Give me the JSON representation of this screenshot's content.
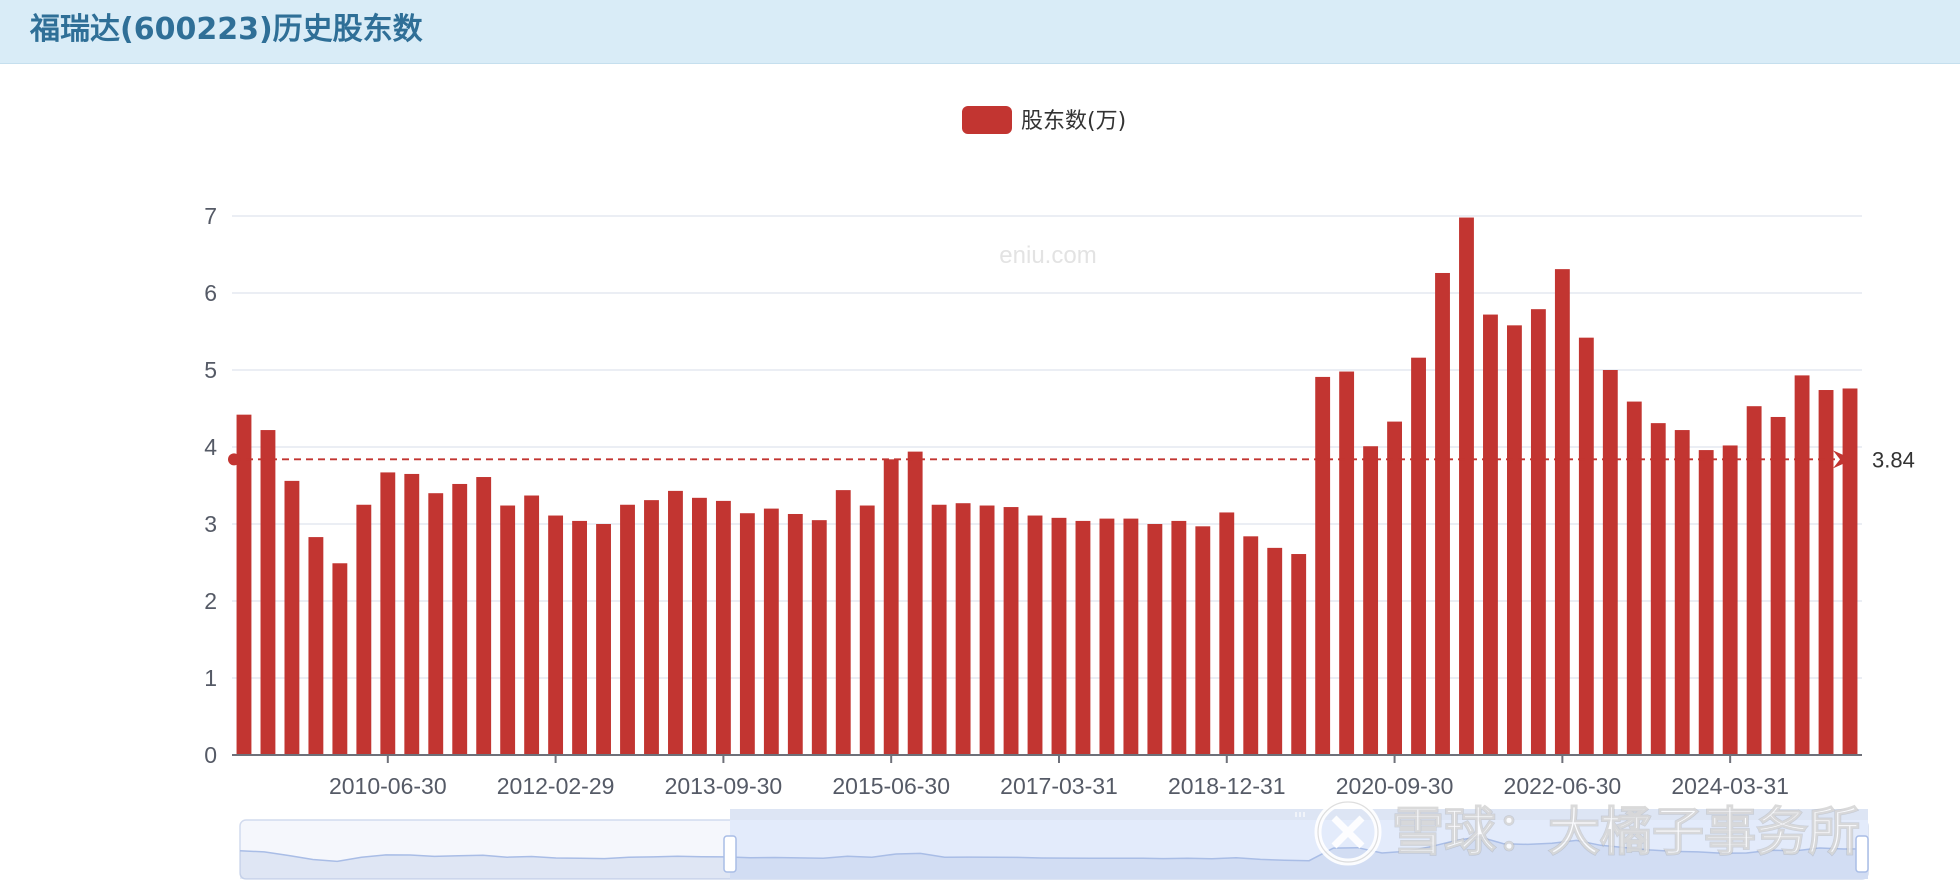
{
  "header": {
    "title": "福瑞达(600223)历史股东数"
  },
  "watermark": "eniu.com",
  "overlay_watermark": "雪球：大橘子事务所",
  "colors": {
    "bar": "#c23531",
    "header_bg": "#d9ecf7",
    "title": "#2f6f97",
    "grid": "#dfe3ee",
    "axis": "#6e7079",
    "zoom_fill": "#e3ebfb"
  },
  "chart_data": {
    "type": "bar",
    "legend": [
      "股东数(万)"
    ],
    "ylim": [
      0,
      7
    ],
    "y_ticks": [
      "0",
      "1",
      "2",
      "3",
      "4",
      "5",
      "6",
      "7"
    ],
    "x_tick_labels": [
      "2010-06-30",
      "2012-02-29",
      "2013-09-30",
      "2015-06-30",
      "2017-03-31",
      "2018-12-31",
      "2020-09-30",
      "2022-06-30",
      "2024-03-31"
    ],
    "x_tick_indices": [
      6,
      13,
      20,
      27,
      34,
      41,
      48,
      55,
      62
    ],
    "grid": true,
    "mark_line": {
      "type": "average",
      "value": 3.84,
      "label": "3.84"
    },
    "series": [
      {
        "name": "股东数(万)",
        "values": [
          4.42,
          4.22,
          3.56,
          2.83,
          2.49,
          3.25,
          3.67,
          3.65,
          3.4,
          3.52,
          3.61,
          3.24,
          3.37,
          3.11,
          3.04,
          3.0,
          3.25,
          3.31,
          3.43,
          3.34,
          3.3,
          3.14,
          3.2,
          3.13,
          3.05,
          3.44,
          3.24,
          3.84,
          3.94,
          3.25,
          3.27,
          3.24,
          3.22,
          3.11,
          3.08,
          3.04,
          3.07,
          3.07,
          3.0,
          3.04,
          2.97,
          3.15,
          2.84,
          2.69,
          2.61,
          4.91,
          4.98,
          4.01,
          4.33,
          5.16,
          6.26,
          6.98,
          5.72,
          5.58,
          5.79,
          6.31,
          5.42,
          5.0,
          4.59,
          4.31,
          4.22,
          3.96,
          4.02,
          4.53,
          4.39,
          4.93,
          4.74,
          4.76
        ]
      }
    ]
  }
}
